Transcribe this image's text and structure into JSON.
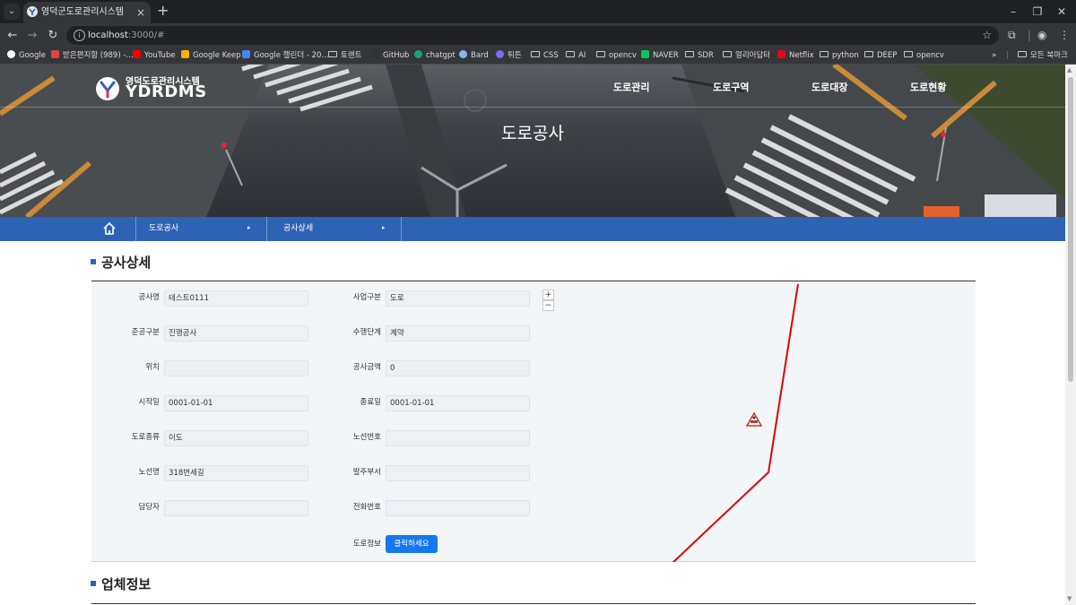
{
  "browser": {
    "tab_title": "영덕군도로관리시스템",
    "url_host": "localhost",
    "url_path": ":3000/#",
    "bookmarks": [
      "Google",
      "받은편지함 (989) -...",
      "YouTube",
      "Google Keep",
      "Google 캘린더 - 20...",
      "토렌트",
      "GitHub",
      "chatgpt",
      "Bard",
      "튀튼",
      "CSS",
      "AI",
      "opencv",
      "NAVER",
      "SDR",
      "얼리어답터",
      "Netflix",
      "python",
      "DEEP",
      "opencv"
    ],
    "all_bookmarks": "모든 북마크",
    "more_bookmarks": "»"
  },
  "header": {
    "logo_sub": "영덕도로관리시스템",
    "logo_main": "YDRDMS",
    "nav": [
      "도로관리",
      "도로구역",
      "도로대장",
      "도로현황"
    ],
    "hero_title": "도로공사"
  },
  "breadcrumb": {
    "items": [
      "도로공사",
      "공사상세"
    ]
  },
  "section1": {
    "title": "공사상세",
    "fields": {
      "construction_name_label": "공사명",
      "construction_name_value": "테스트0111",
      "business_type_label": "사업구분",
      "business_type_value": "도로",
      "completion_type_label": "준공구분",
      "completion_type_value": "진행공사",
      "stage_label": "수행단계",
      "stage_value": "계약",
      "location_label": "위치",
      "location_value": "",
      "amount_label": "공사금액",
      "amount_value": "0",
      "start_label": "시작일",
      "start_value": "0001-01-01",
      "end_label": "종료일",
      "end_value": "0001-01-01",
      "road_type_label": "도로종류",
      "road_type_value": "이도",
      "route_no_label": "노선번호",
      "route_no_value": "",
      "route_name_label": "노선명",
      "route_name_value": "318번세길",
      "ordering_dept_label": "발주부서",
      "ordering_dept_value": "",
      "manager_label": "담당자",
      "manager_value": "",
      "phone_label": "전화번호",
      "phone_value": "",
      "road_info_label": "도로정보",
      "road_info_button": "클릭하세요"
    },
    "map": {
      "zoom_in": "+",
      "zoom_out": "−",
      "line_color": "#e00000"
    }
  },
  "section2": {
    "title": "업체정보"
  },
  "colors": {
    "accent": "#2e62b5",
    "button": "#1478f0"
  }
}
